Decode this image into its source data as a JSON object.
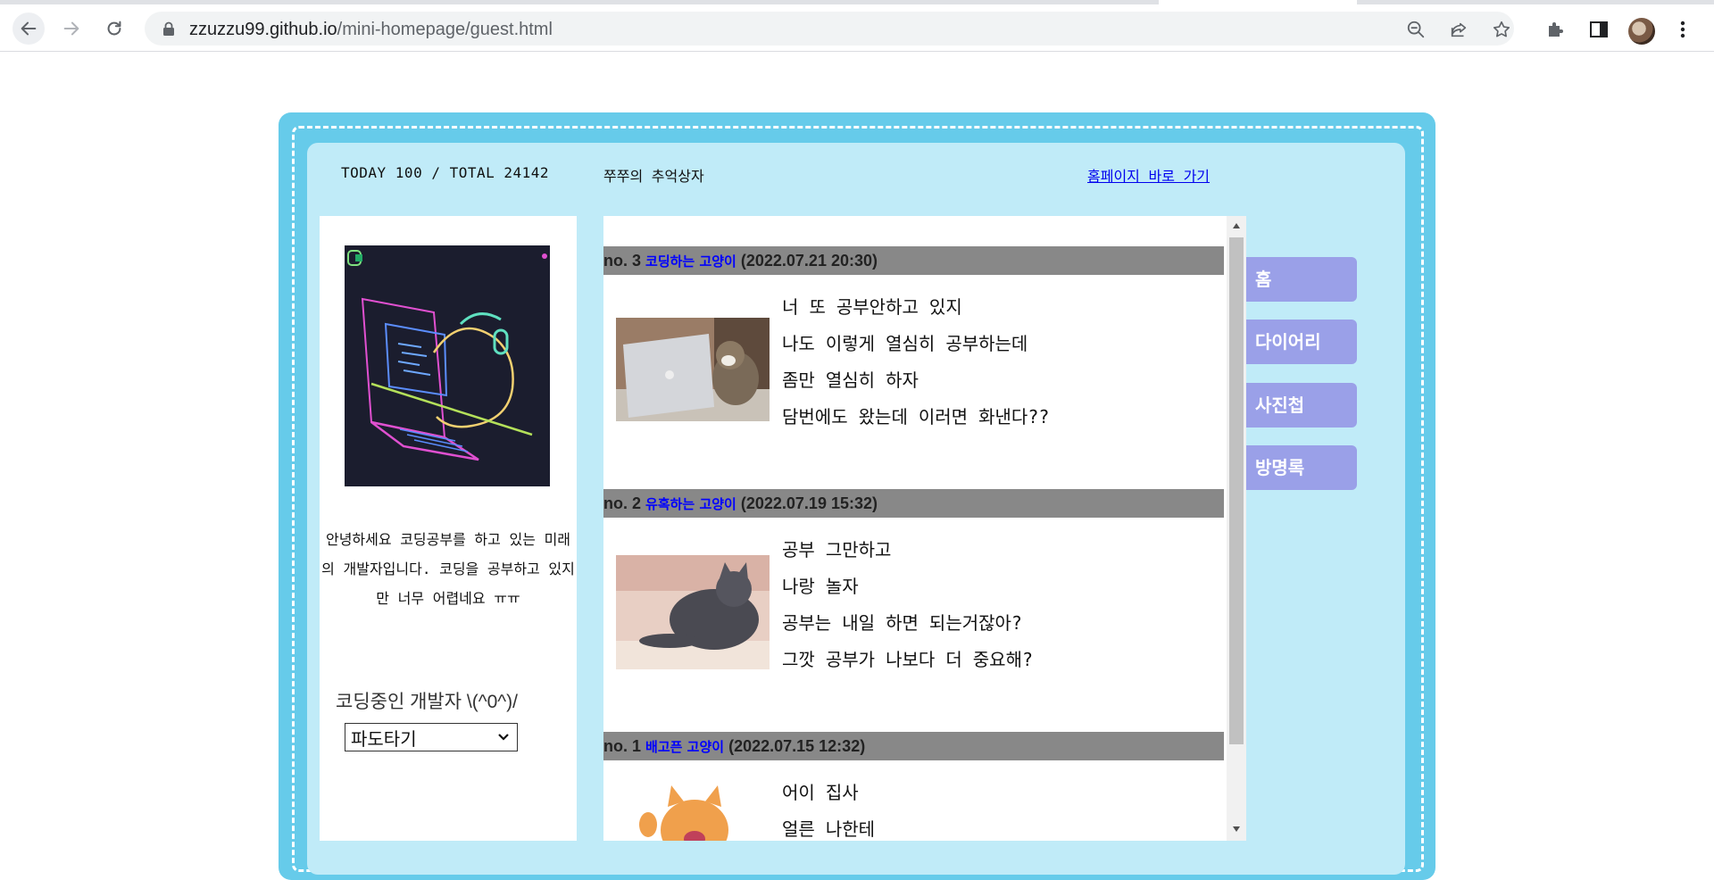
{
  "browser": {
    "url_host": "zzuzzu99.github.io",
    "url_path": "/mini-homepage/guest.html"
  },
  "header": {
    "counter": "TODAY 100 / TOTAL 24142",
    "site_title": "쭈쭈의 추억상자",
    "home_link": "홈페이지 바로 가기"
  },
  "profile": {
    "intro": "안녕하세요 코딩공부를 하고 있는 미래의 개발자입니다. 코딩을 공부하고 있지만 너무 어렵네요 ㅠㅠ",
    "caption": "코딩중인 개발자 \\(^0^)/",
    "select_value": "파도타기"
  },
  "guestbook": {
    "entries": [
      {
        "number": "no. 3",
        "nickname": "코딩하는 고양이",
        "date": "(2022.07.21 20:30)",
        "lines": [
          "너 또 공부안하고 있지",
          "나도 이렇게 열심히 공부하는데",
          "좀만 열심히 하자",
          "담번에도 왔는데 이러면 화낸다??"
        ]
      },
      {
        "number": "no. 2",
        "nickname": "유혹하는 고양이",
        "date": "(2022.07.19 15:32)",
        "lines": [
          "공부 그만하고",
          "나랑 놀자",
          "공부는 내일 하면 되는거잖아?",
          "그깟 공부가 나보다 더 중요해?"
        ]
      },
      {
        "number": "no. 1",
        "nickname": "배고픈 고양이",
        "date": "(2022.07.15 12:32)",
        "lines": [
          "어이 집사",
          "얼른 나한테"
        ]
      }
    ]
  },
  "menu": {
    "items": [
      "홈",
      "다이어리",
      "사진첩",
      "방명록"
    ]
  },
  "colors": {
    "frame": "#66cbea",
    "inner": "#c0ebf8",
    "menu": "#9aa0e8",
    "entry_header": "#888888",
    "nickname": "#0000ff"
  }
}
